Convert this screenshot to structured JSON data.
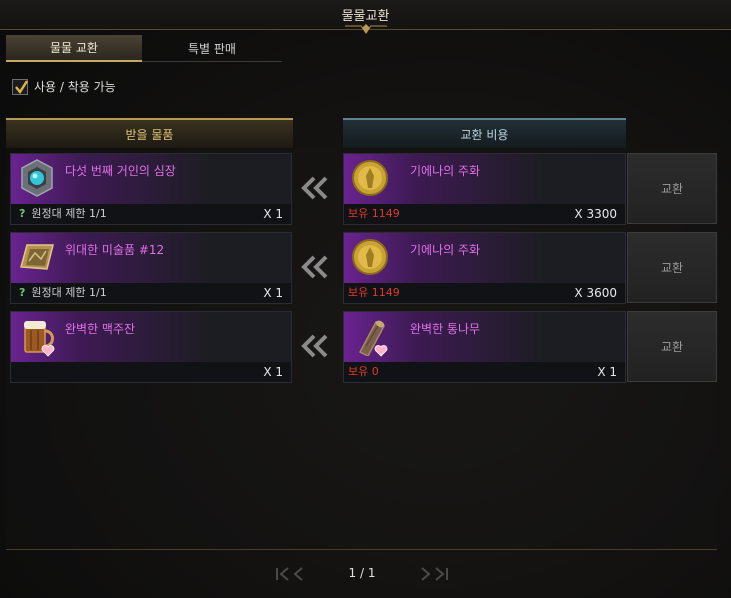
{
  "window": {
    "title": "물물교환"
  },
  "tabs": [
    {
      "label": "물물 교환",
      "active": true
    },
    {
      "label": "특별 판매",
      "active": false
    }
  ],
  "filter": {
    "label": "사용 / 착용 가능",
    "checked": true
  },
  "columns": {
    "receive": "받을 물품",
    "cost": "교환 비용"
  },
  "trades": [
    {
      "receive": {
        "name": "다섯 번째 거인의 심장",
        "note": "원정대 제한 1/1",
        "qty": "X 1",
        "icon": "giant-heart-icon"
      },
      "cost": {
        "name": "기에나의 주화",
        "owned": "보유 1149",
        "qty": "X 3300",
        "icon": "gold-coin-icon"
      },
      "button": "교환"
    },
    {
      "receive": {
        "name": "위대한 미술품 #12",
        "note": "원정대 제한 1/1",
        "qty": "X 1",
        "icon": "painting-icon"
      },
      "cost": {
        "name": "기에나의 주화",
        "owned": "보유 1149",
        "qty": "X 3600",
        "icon": "gold-coin-icon"
      },
      "button": "교환"
    },
    {
      "receive": {
        "name": "완벽한 맥주잔",
        "note": "",
        "qty": "X 1",
        "icon": "beer-mug-icon"
      },
      "cost": {
        "name": "완벽한 통나무",
        "owned": "보유 0",
        "qty": "X 1",
        "icon": "log-icon"
      },
      "button": "교환"
    }
  ],
  "pagination": {
    "page": "1 / 1"
  },
  "colors": {
    "accent_gold": "#c9a863",
    "item_purple": "#e070e8",
    "owned_red": "#e03a2a",
    "restriction_green": "#6fc36f"
  }
}
